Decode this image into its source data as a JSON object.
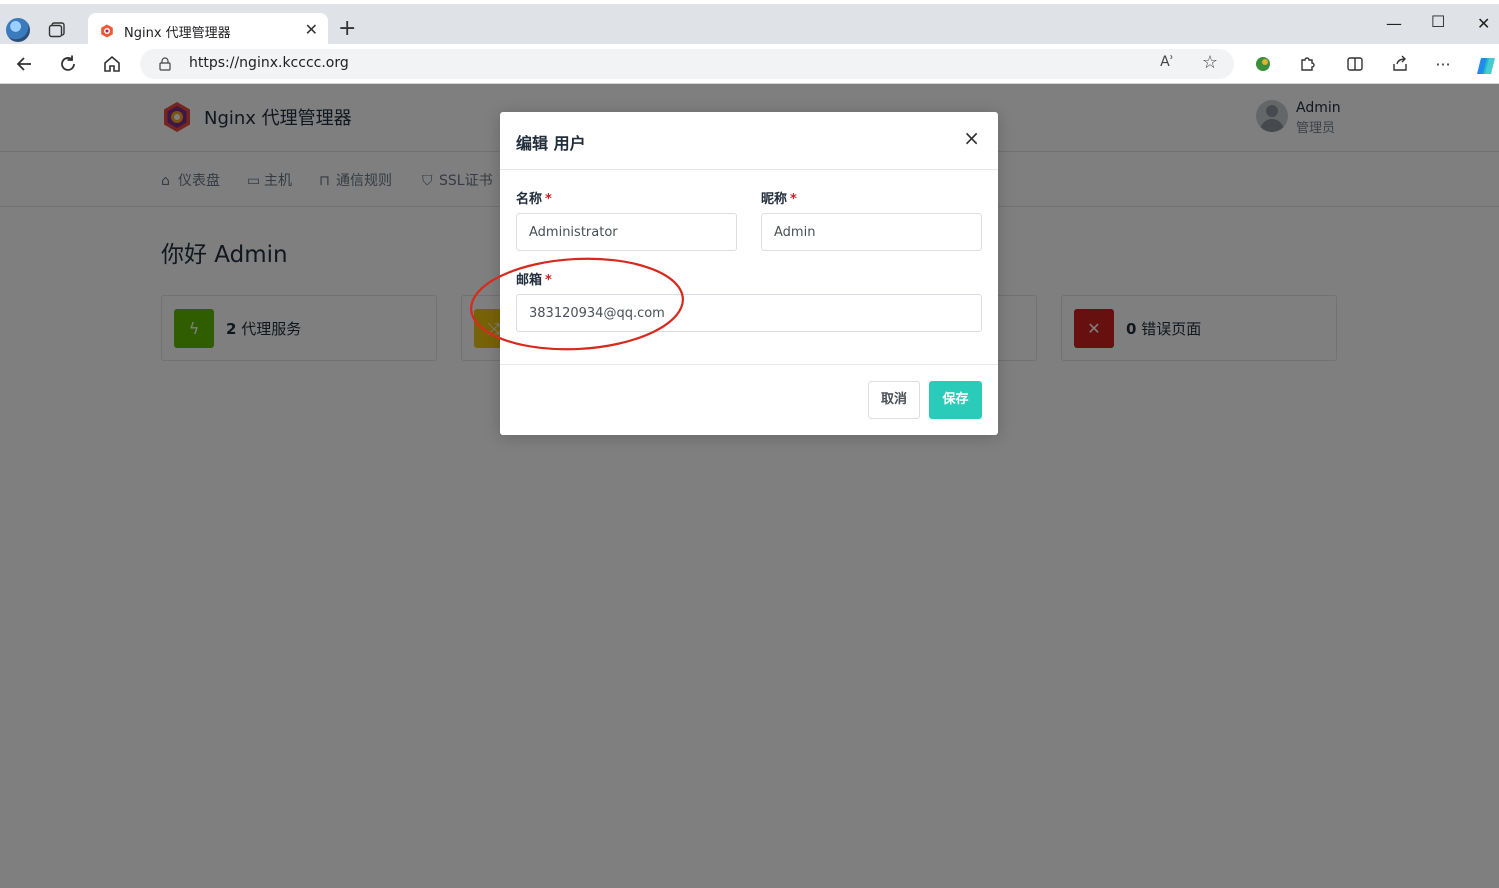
{
  "browser": {
    "tab_title": "Nginx 代理管理器",
    "tab_close": "✕",
    "new_tab": "+",
    "url": "https://nginx.kcccc.org",
    "read_aloud": "Aʾ",
    "window_controls": {
      "minimize": "—",
      "maximize": "☐",
      "close": "✕"
    }
  },
  "app": {
    "brand": "Nginx 代理管理器",
    "user": {
      "name": "Admin",
      "role": "管理员"
    },
    "nav": [
      {
        "label": "仪表盘",
        "icon": "home-icon"
      },
      {
        "label": "主机",
        "icon": "monitor-icon"
      },
      {
        "label": "通信规则",
        "icon": "lock-icon"
      },
      {
        "label": "SSL证书",
        "icon": "shield-icon"
      }
    ],
    "greeting": "你好 Admin",
    "cards": [
      {
        "count": "2",
        "label": "代理服务",
        "color": "#5eba00",
        "icon": "bolt-icon"
      },
      {
        "count": "",
        "label": "",
        "color": "#f1c40f",
        "icon": "shuffle-icon"
      },
      {
        "count": "0",
        "label": "错误页面",
        "color": "#cd201f",
        "icon": "zap-off-icon"
      }
    ]
  },
  "modal": {
    "title": "编辑 用户",
    "close": "×",
    "fields": {
      "name": {
        "label": "名称",
        "required": "*",
        "value": "Administrator"
      },
      "nickname": {
        "label": "昵称",
        "required": "*",
        "value": "Admin"
      },
      "email": {
        "label": "邮箱",
        "required": "*",
        "value": "383120934@qq.com"
      }
    },
    "cancel_label": "取消",
    "save_label": "保存"
  },
  "colors": {
    "accent": "#2bcbba",
    "annotation": "#d62a1e",
    "required": "#cd201f"
  }
}
